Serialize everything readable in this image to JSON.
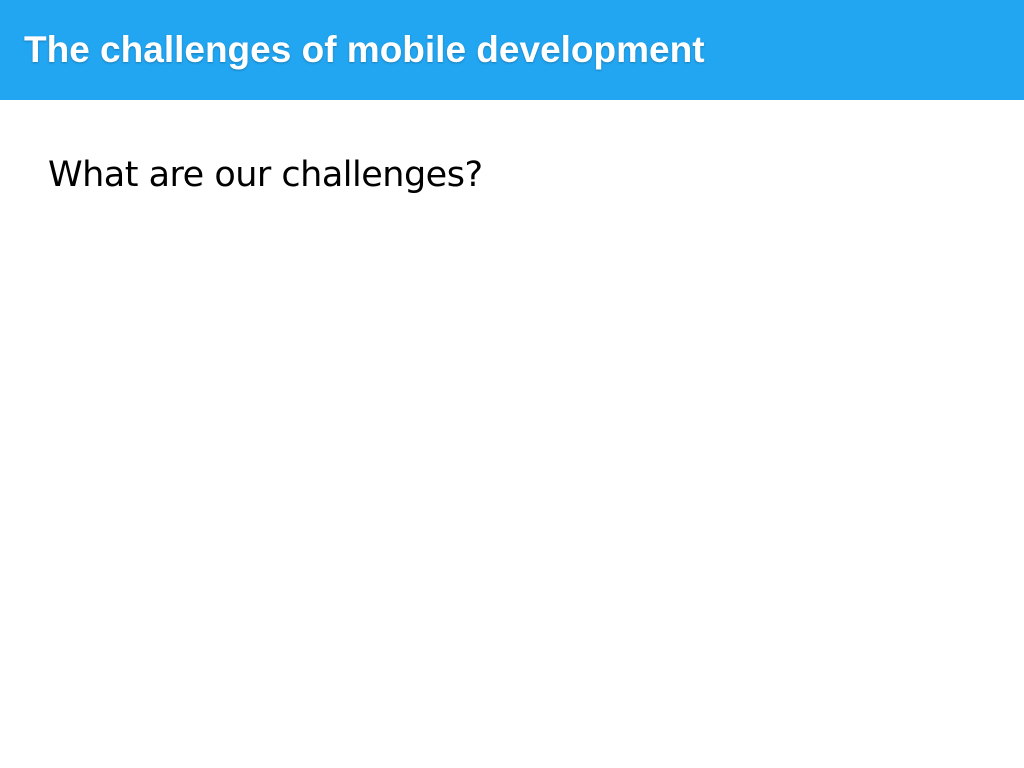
{
  "slide": {
    "title": "The challenges of mobile development",
    "body_text": "What are our challenges?"
  },
  "colors": {
    "title_bar": "#22a6f2",
    "title_text": "#ffffff",
    "body_text": "#000000",
    "background": "#ffffff"
  }
}
